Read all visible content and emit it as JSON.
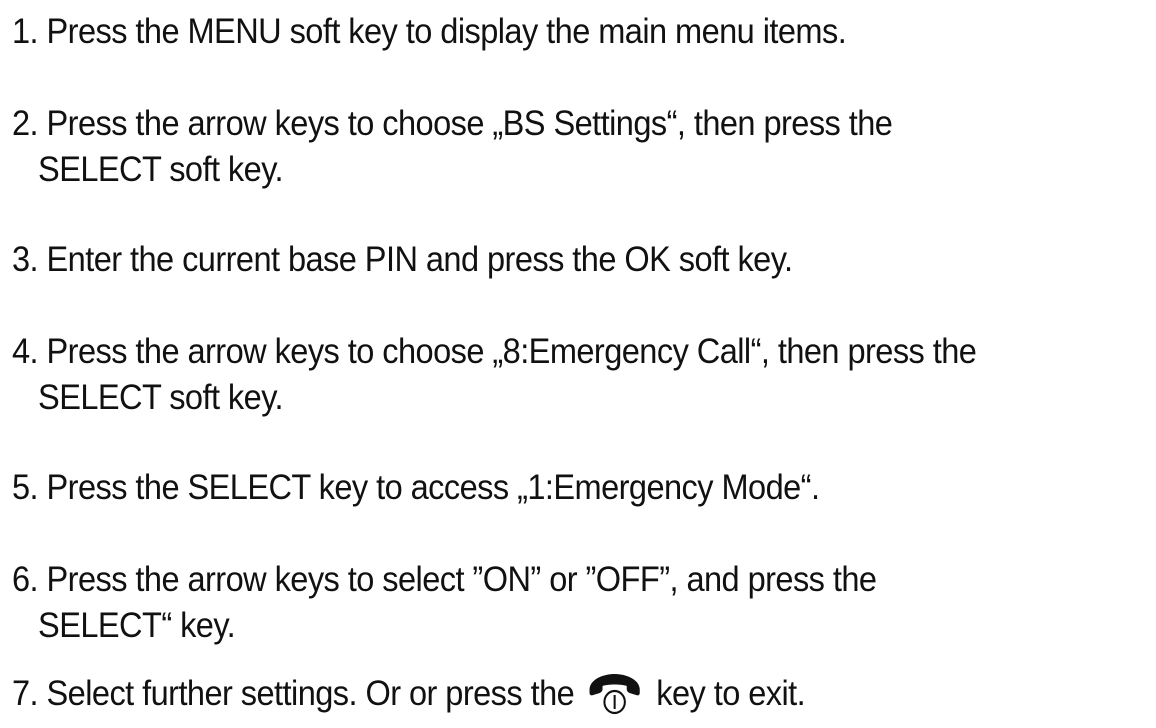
{
  "steps": [
    {
      "number": "1.",
      "lines": [
        "Press the MENU soft key to display the main menu items."
      ]
    },
    {
      "number": "2.",
      "lines": [
        "Press the arrow keys to choose „BS Settings“, then press the",
        "SELECT soft key."
      ]
    },
    {
      "number": "3.",
      "lines": [
        "Enter the current base PIN and press the OK soft key."
      ]
    },
    {
      "number": "4.",
      "lines": [
        "Press the arrow keys to choose „8:Emergency Call“, then press the",
        "SELECT soft key."
      ]
    },
    {
      "number": "5.",
      "lines": [
        "Press the SELECT key to access  „1:Emergency Mode“."
      ]
    },
    {
      "number": "6.",
      "lines": [
        "Press the arrow keys to select ”ON” or ”OFF”, and press the",
        "SELECT“ key."
      ]
    },
    {
      "number": "7.",
      "text_before_icon": "Select further settings. Or or press the",
      "icon": "end-call-handset-icon",
      "text_after_icon": "key to exit."
    }
  ]
}
